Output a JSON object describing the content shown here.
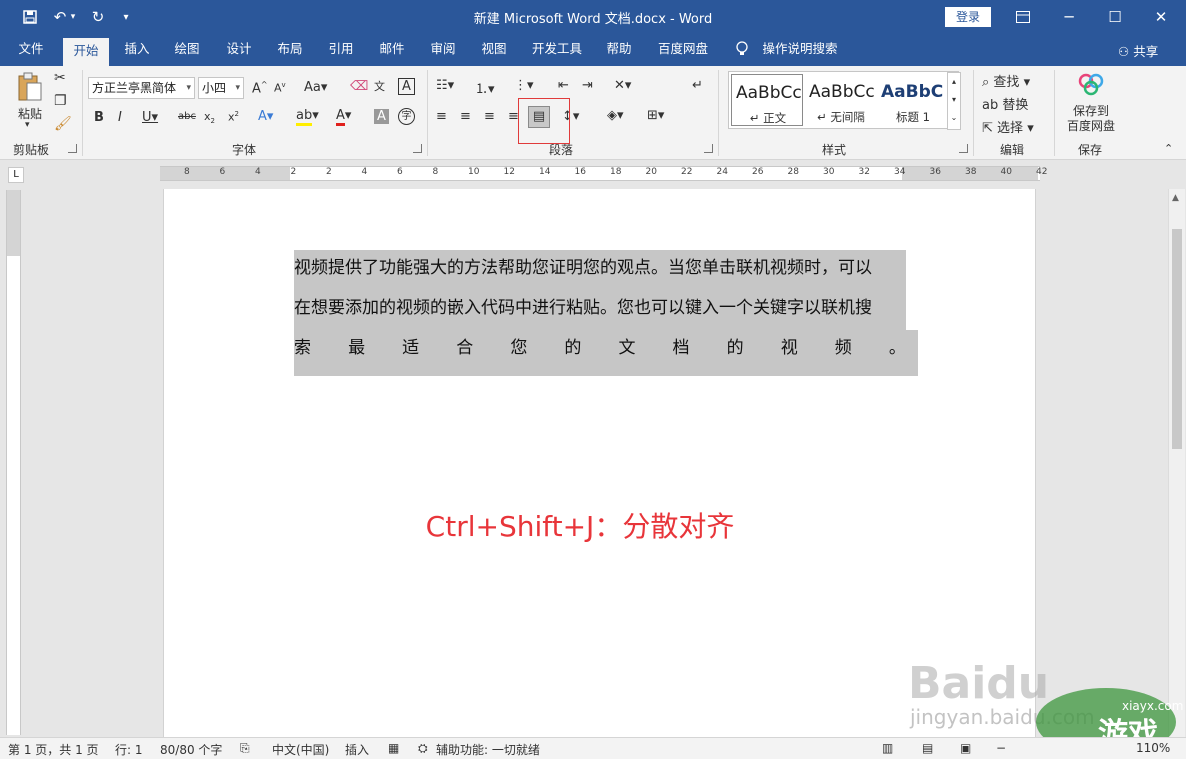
{
  "window": {
    "title": "新建 Microsoft Word 文档.docx  -  Word",
    "login": "登录"
  },
  "tabs": [
    "文件",
    "开始",
    "插入",
    "绘图",
    "设计",
    "布局",
    "引用",
    "邮件",
    "审阅",
    "视图",
    "开发工具",
    "帮助",
    "百度网盘"
  ],
  "tell_me": "操作说明搜索",
  "share": "共享",
  "ribbon": {
    "clipboard": {
      "paste": "粘贴",
      "label": "剪贴板"
    },
    "font": {
      "name": "方正兰亭黑简体",
      "size": "小四",
      "label": "字体"
    },
    "paragraph": {
      "label": "段落"
    },
    "styles": {
      "label": "样式",
      "items": [
        {
          "preview": "AaBbCcI",
          "name": "正文"
        },
        {
          "preview": "AaBbCcI",
          "name": "无间隔"
        },
        {
          "preview": "AaBbC",
          "name": "标题 1"
        }
      ]
    },
    "editing": {
      "find": "查找",
      "replace": "替换",
      "select": "选择",
      "label": "编辑"
    },
    "save": {
      "btn_line1": "保存到",
      "btn_line2": "百度网盘",
      "label": "保存"
    }
  },
  "document": {
    "line1": "视频提供了功能强大的方法帮助您证明您的观点。当您单击联机视频时，可以",
    "line2": "在想要添加的视频的嵌入代码中进行粘贴。您也可以键入一个关键字以联机搜",
    "line3_chars": [
      "索",
      "最",
      "适",
      "合",
      "您",
      "的",
      "文",
      "档",
      "的",
      "视",
      "频",
      "。"
    ],
    "annotation": "Ctrl+Shift+J：分散对齐"
  },
  "ruler_numbers": [
    "8",
    "6",
    "4",
    "2",
    "2",
    "4",
    "6",
    "8",
    "10",
    "12",
    "14",
    "16",
    "18",
    "20",
    "22",
    "24",
    "26",
    "28",
    "30",
    "32",
    "34",
    "36",
    "38",
    "40",
    "42"
  ],
  "status": {
    "page": "第 1 页，共 1 页",
    "line": "行: 1",
    "words": "80/80 个字",
    "lang": "中文(中国)",
    "mode": "插入",
    "access": "辅助功能: 一切就绪",
    "zoom": "110%"
  },
  "watermark": {
    "baidu": "Baidu",
    "jingyan": "jingyan.baidu.com",
    "site": "xiayx.com",
    "logo_text": "游戏"
  }
}
